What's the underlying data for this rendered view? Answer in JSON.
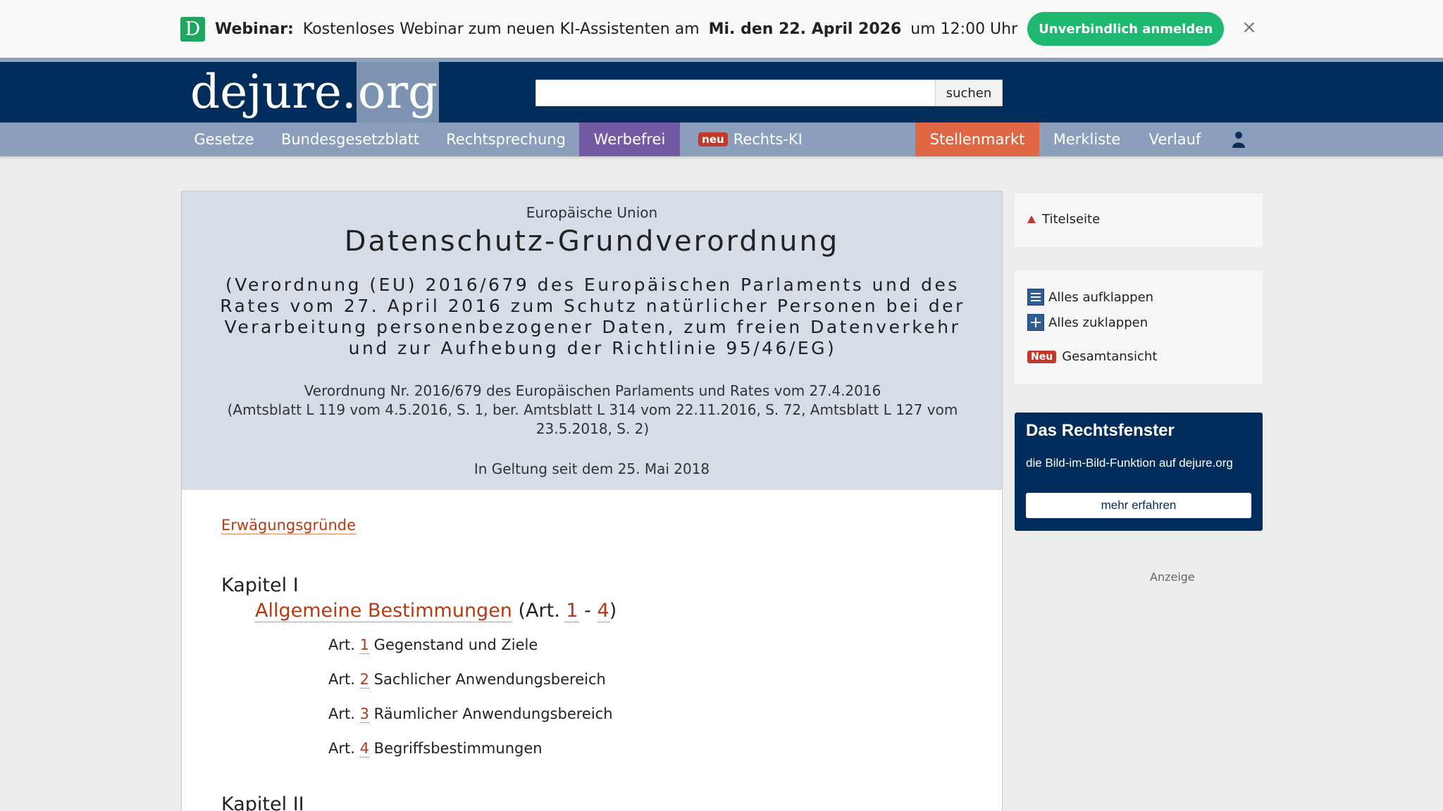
{
  "banner": {
    "logo_letter": "D",
    "label": "Webinar:",
    "text": "Kostenloses Webinar zum neuen KI-Assistenten am",
    "date": "Mi. den 22. April 2026",
    "time": "um 12:00 Uhr",
    "cta": "Unverbindlich anmelden",
    "close": "×"
  },
  "header": {
    "logo_main": "dejure.",
    "logo_org": "org",
    "search_placeholder": "",
    "search_button": "suchen"
  },
  "nav": {
    "gesetze": "Gesetze",
    "bgbl": "Bundesgesetzblatt",
    "rechtsprechung": "Rechtsprechung",
    "werbefrei": "Werbefrei",
    "neu_badge": "neu",
    "rechts_ki": "Rechts-KI",
    "stellenmarkt": "Stellenmarkt",
    "merkliste": "Merkliste",
    "verlauf": "Verlauf"
  },
  "doc": {
    "union": "Europäische Union",
    "title": "Datenschutz-Grundverordnung",
    "subtitle": "(Verordnung (EU) 2016/679 des Europäischen Parlaments und des Rates vom 27. April 2016 zum Schutz natürlicher Personen bei der Verarbeitung personenbezogener Daten, zum freien Datenverkehr und zur Aufhebung der Richtlinie 95/46/EG)",
    "vo_line1": "Verordnung Nr. 2016/679 des Europäischen Parlaments und Rates vom 27.4.2016",
    "vo_line2": "(Amtsblatt L 119 vom 4.5.2016, S. 1, ber. Amtsblatt L 314 vom 22.11.2016, S. 72, Amtsblatt L 127 vom 23.5.2018, S. 2)",
    "geltung": "In Geltung seit dem 25. Mai 2018"
  },
  "toc": {
    "erwaegungsgruende": "Erwägungsgründe",
    "kapitel1": "Kapitel I",
    "kapitel1_title": "Allgemeine Bestimmungen",
    "kapitel1_range_open": "(Art.",
    "kapitel1_from": "1",
    "kapitel1_dash": "-",
    "kapitel1_to": "4",
    "kapitel1_close": ")",
    "art_prefix": "Art.",
    "articles": [
      {
        "num": "1",
        "title": "Gegenstand und Ziele"
      },
      {
        "num": "2",
        "title": "Sachlicher Anwendungsbereich"
      },
      {
        "num": "3",
        "title": "Räumlicher Anwendungsbereich"
      },
      {
        "num": "4",
        "title": "Begriffsbestimmungen"
      }
    ],
    "kapitel2": "Kapitel II"
  },
  "sidebar": {
    "titelseite": "Titelseite",
    "aufklappen": "Alles aufklappen",
    "zuklappen": "Alles zuklappen",
    "neu": "Neu",
    "gesamtansicht": "Gesamtansicht"
  },
  "rechtsfenster": {
    "title": "Das Rechtsfenster",
    "text": "die Bild-im-Bild-Funktion auf dejure.org",
    "button": "mehr erfahren"
  },
  "anzeige": "Anzeige",
  "colors": {
    "header_bg": "#012d5c",
    "nav_bg": "#8b9fbd",
    "werbefrei_bg": "#735aa5",
    "stellenmarkt_bg": "#e06743",
    "link": "#b33a12",
    "cta_green": "#1fb870"
  }
}
